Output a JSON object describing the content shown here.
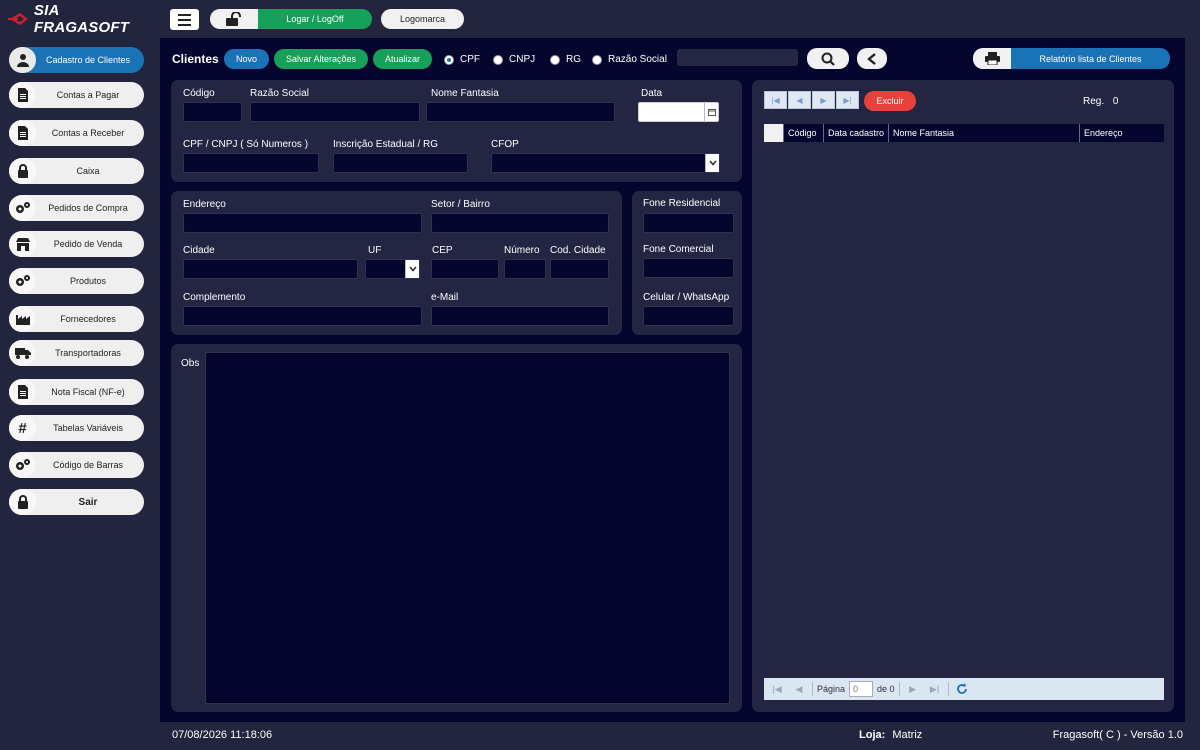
{
  "app": {
    "brand": "SIA FRAGASOFT",
    "brand_color": "#d0202a"
  },
  "topbar": {
    "login_label": "Logar / LogOff",
    "logo_label": "Logomarca"
  },
  "sidebar": {
    "items": [
      {
        "label": "Cadastro de Clientes",
        "icon": "user-icon"
      },
      {
        "label": "Contas a Pagar",
        "icon": "document-icon"
      },
      {
        "label": "Contas a Receber",
        "icon": "document-icon"
      },
      {
        "label": "Caixa",
        "icon": "lock-icon"
      },
      {
        "label": "Pedidos de Compra",
        "icon": "gears-icon"
      },
      {
        "label": "Pedido de Venda",
        "icon": "store-icon"
      },
      {
        "label": "Produtos",
        "icon": "gears-icon"
      },
      {
        "label": "Fornecedores",
        "icon": "factory-icon"
      },
      {
        "label": "Transportadoras",
        "icon": "truck-icon"
      },
      {
        "label": "Nota Fiscal (NF-e)",
        "icon": "document-icon"
      },
      {
        "label": "Tabelas Variáveis",
        "icon": "hash-icon"
      },
      {
        "label": "Código de Barras",
        "icon": "gears-icon"
      },
      {
        "label": "Sair",
        "icon": "lock-icon"
      }
    ]
  },
  "toolbar": {
    "title": "Clientes",
    "novo": "Novo",
    "salvar": "Salvar Alterações",
    "atualizar": "Atualizar",
    "radios": [
      "CPF",
      "CNPJ",
      "RG",
      "Razão Social"
    ],
    "selected_radio": "CPF",
    "report": "Relatório lista de Clientes"
  },
  "form": {
    "codigo": "Código",
    "razao_social": "Razão Social",
    "nome_fantasia": "Nome Fantasia",
    "data": "Data",
    "cpf_cnpj": "CPF / CNPJ ( Só Numeros )",
    "inscricao": "Inscrição Estadual / RG",
    "cfop": "CFOP",
    "endereco": "Endereço",
    "setor": "Setor / Bairro",
    "cidade": "Cidade",
    "uf": "UF",
    "cep": "CEP",
    "numero": "Número",
    "cod_cidade": "Cod. Cidade",
    "complemento": "Complemento",
    "email": "e-Mail",
    "fone_res": "Fone Residencial",
    "fone_com": "Fone Comercial",
    "celular": "Celular / WhatsApp",
    "obs": "Obs"
  },
  "grid": {
    "excluir": "Excluir",
    "reg_label": "Reg.",
    "reg_count": "0",
    "columns": [
      "Código",
      "Data cadastro",
      "Nome Fantasia",
      "Endereço"
    ],
    "pager": {
      "page_label": "Página",
      "page_value": "0",
      "of_label": "de 0"
    }
  },
  "footer": {
    "datetime": "07/08/2026 11:18:06",
    "loja_label": "Loja:",
    "loja_value": "Matriz",
    "version": "Fragasoft( C ) - Versão 1.0"
  }
}
